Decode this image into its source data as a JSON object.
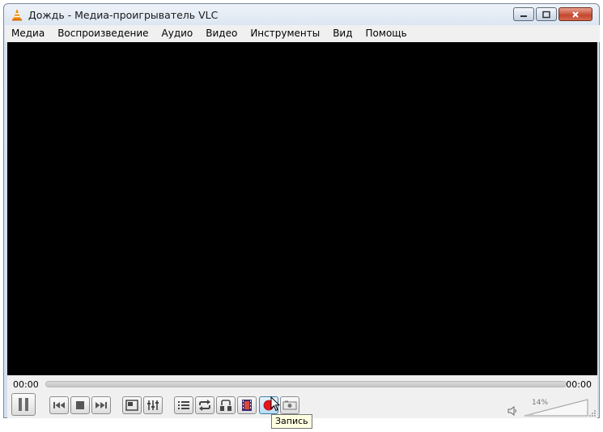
{
  "window": {
    "title": "Дождь - Медиа-проигрыватель VLC",
    "app_icon": "vlc-cone-icon"
  },
  "menu": [
    {
      "label": "Медиа"
    },
    {
      "label": "Воспроизведение"
    },
    {
      "label": "Аудио"
    },
    {
      "label": "Видео"
    },
    {
      "label": "Инструменты"
    },
    {
      "label": "Вид"
    },
    {
      "label": "Помощь"
    }
  ],
  "player": {
    "elapsed": "00:00",
    "total": "00:00",
    "progress": 0
  },
  "controls": {
    "pause_icon": "pause-icon",
    "previous_icon": "previous-icon",
    "stop_icon": "stop-icon",
    "next_icon": "next-icon",
    "fullscreen_icon": "fullscreen-icon",
    "extended_settings_icon": "equalizer-icon",
    "playlist_icon": "playlist-icon",
    "loop_icon": "loop-icon",
    "ab_loop_icon": "ab-loop-icon",
    "frame_by_frame_icon": "film-frame-icon",
    "record_icon": "record-icon",
    "snapshot_icon": "snapshot-icon",
    "record_tooltip": "Запись"
  },
  "volume": {
    "label": "14%",
    "value": 14
  },
  "colors": {
    "record": "#e8141b",
    "video_background": "#000000",
    "active_button": "#b9dbf4"
  }
}
